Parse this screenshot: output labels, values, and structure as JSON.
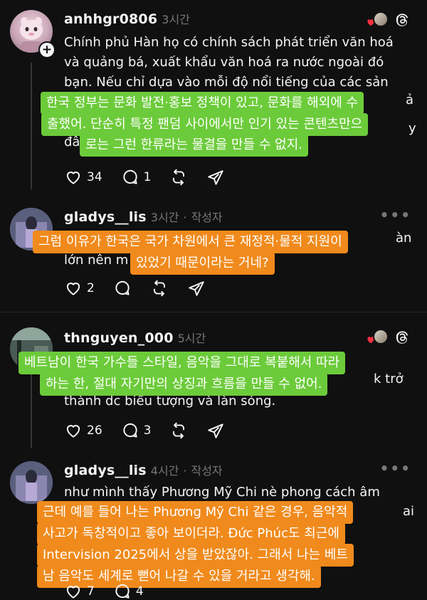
{
  "posts": [
    {
      "username": "anhhgr0806",
      "time": "3시간",
      "text_lines": [
        "Chính phủ Hàn họ có chính sách phát triển văn hoá",
        "và quảng bá, xuất khẩu văn hoá ra nước ngoài đó",
        "bạn. Nếu chỉ dựa vào mỗi độ nổi tiếng của các sản",
        "",
        "",
        "đâ"
      ],
      "likes": "34",
      "replies": "1",
      "overlay_color": "#6ccb3a",
      "overlay_lines": [
        "한국 정부는 문화 발전·홍보 정책이 있고, 문화를 해외에 수",
        "출했어. 단순히 특정 팬덤 사이에서만 인기 있는 콘텐츠만으",
        "로는 그런 한류라는 물결을 만들 수 없지."
      ]
    },
    {
      "username": "gladys__lis",
      "time": "3시간",
      "author_tag": "작성자",
      "text_lines": [
        "",
        "lớn nên m"
      ],
      "likes": "2",
      "overlay_color": "#f08a1c",
      "overlay_lines": [
        "그럼 이유가 한국은 국가 차원에서 큰 재정적·물적 지원이",
        "있었기 때문이라는 거네?"
      ]
    },
    {
      "username": "thnguyen_000",
      "time": "5시간",
      "text_lines": [
        "",
        "",
        "thành dc biểu tượng và làn sóng."
      ],
      "likes": "26",
      "replies": "3",
      "overlay_color": "#6ccb3a",
      "overlay_lines": [
        "베트남이 한국 가수들 스타일, 음악을 그대로 복붙해서 따라",
        "하는 한, 절대 자기만의 상징과 흐름을 만들 수 없어."
      ]
    },
    {
      "username": "gladys__lis",
      "time": "4시간",
      "author_tag": "작성자",
      "text_lines": [
        "như mình thấy Phương Mỹ Chi nè phong cách âm"
      ],
      "likes": "7",
      "replies": "4",
      "overlay_color": "#f08a1c",
      "overlay_lines": [
        "근데 예를 들어 나는 Phương Mỹ Chi 같은 경우, 음악적",
        "사고가 독창적이고 좋아 보이더라. Đức Phúc도 최근에",
        "Intervision 2025에서 상을 받았잖아. 그래서 나는 베트",
        "남 음악도 세계로 뻗어 나갈 수 있을 거라고 생각해."
      ]
    }
  ],
  "meta_separator": "·",
  "more_label": "•••",
  "plus_label": "+",
  "right_fragments": {
    "p1_edge": "ả",
    "p1_edge2": "y",
    "p2_edge": "àn",
    "p3_edge": "k trở",
    "p4_edge": "ai"
  },
  "icons": [
    "heart-icon",
    "comment-icon",
    "repost-icon",
    "share-icon",
    "threads-logo-icon",
    "more-icon",
    "plus-icon"
  ]
}
